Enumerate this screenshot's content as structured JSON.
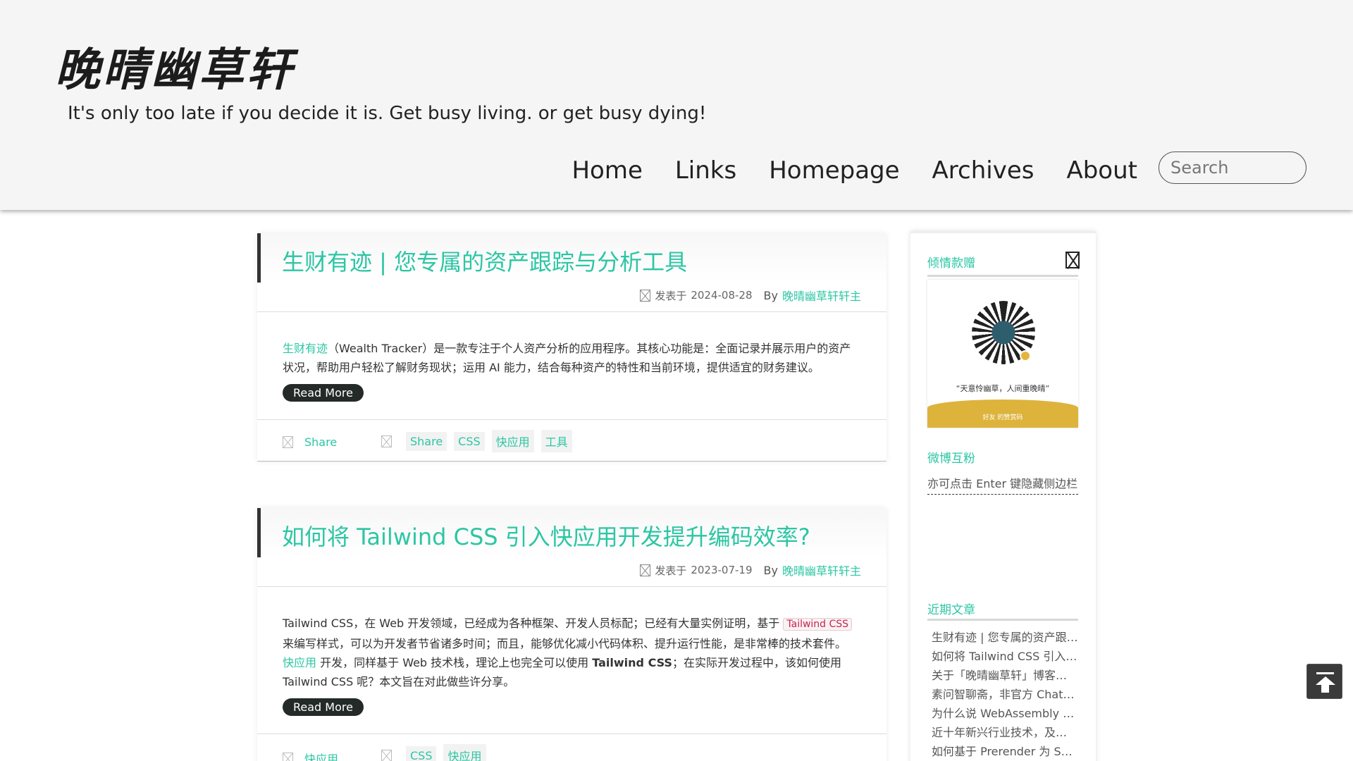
{
  "site": {
    "logo": "晚晴幽草轩",
    "tagline": "It's only too late if you decide it is. Get busy living. or get busy dying!"
  },
  "nav": {
    "items": [
      {
        "label": "Home"
      },
      {
        "label": "Links"
      },
      {
        "label": "Homepage"
      },
      {
        "label": "Archives"
      },
      {
        "label": "About"
      }
    ],
    "search_placeholder": "Search"
  },
  "posts": [
    {
      "title": "生财有迹 | 您专属的资产跟踪与分析工具",
      "date_prefix": "发表于",
      "date": "2024-08-28",
      "by": "By",
      "author": "晚晴幽草轩轩主",
      "excerpt_link": "生财有迹",
      "excerpt": "（Wealth Tracker）是一款专注于个人资产分析的应用程序。其核心功能是：全面记录并展示用户的资产状况，帮助用户轻松了解财务现状；运用 AI 能力，结合每种资产的特性和当前环境，提供适宜的财务建议。",
      "read_more": "Read More",
      "share": "Share",
      "tags": [
        "Share",
        "CSS",
        "快应用",
        "工具"
      ]
    },
    {
      "title": "如何将 Tailwind CSS 引入快应用开发提升编码效率?",
      "date_prefix": "发表于",
      "date": "2023-07-19",
      "by": "By",
      "author": "晚晴幽草轩轩主",
      "excerpt_a": "Tailwind CSS，在 Web 开发领域，已经成为各种框架、开发人员标配；已经有大量实例证明，基于",
      "excerpt_code": "Tailwind CSS",
      "excerpt_b": "来编写样式，可以为开发者节省诸多时间；而且，能够优化减小代码体积、提升运行性能，是非常棒的技术套件。",
      "excerpt_link": "快应用",
      "excerpt_c": "开发，同样基于 Web 技术栈，理论上也完全可以使用",
      "excerpt_bold": "Tailwind CSS",
      "excerpt_d": "；在实际开发过程中，该如何使用 Tailwind CSS 呢？本文旨在对此做些许分享。",
      "read_more": "Read More",
      "share": "快应用",
      "tags": [
        "CSS",
        "快应用"
      ]
    }
  ],
  "sidebar": {
    "donate_title": "倾情款赠",
    "qr_caption": "“天意怜幽草，人间重晚晴”",
    "qr_band_text": "好友 的赞赏码",
    "weibo_title": "微博互粉",
    "weibo_text": "亦可点击 Enter 键隐藏侧边栏",
    "recent_title": "近期文章",
    "recent": [
      "生财有迹 | 您专属的资产跟踪与分析工具",
      "如何将 Tailwind CSS 引入快应用开发提升编码效率?",
      "关于「晚晴幽草轩」博客的一些说明",
      "素问智聊斋，非官方 ChatGPT 客户端",
      "为什么说 WebAssembly 是未来",
      "近十年新兴行业技术，及其发展趋势",
      "如何基于 Prerender 为 SPA 做 SEO 优化"
    ]
  },
  "colors": {
    "accent": "#2cc6a4",
    "header_bg": "#f5f5f5",
    "read_more_bg": "#232a28",
    "code_text": "#c7254e",
    "qr_band": "#ddb33c"
  }
}
